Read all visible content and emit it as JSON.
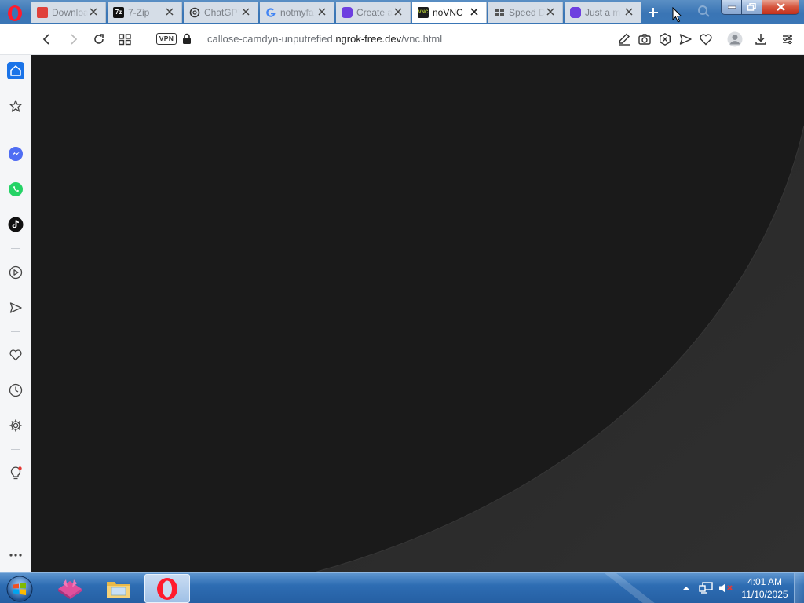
{
  "browser": {
    "name": "Opera",
    "tabs": [
      {
        "title": "Downloa",
        "favicon": "pdf-icon",
        "color": "#e0413b"
      },
      {
        "title": "7-Zip",
        "favicon": "7zip-icon",
        "color": "#111111"
      },
      {
        "title": "ChatGPT",
        "favicon": "chatgpt-icon",
        "color": "#333333"
      },
      {
        "title": "notmyfa",
        "favicon": "google-icon",
        "color": "#4285f4"
      },
      {
        "title": "Create a",
        "favicon": "app-icon",
        "color": "#6d3fe0"
      },
      {
        "title": "noVNC",
        "favicon": "novnc-icon",
        "color": "#1c1c1c",
        "active": true
      },
      {
        "title": "Speed D",
        "favicon": "speed-dial-icon",
        "color": "#2b3440"
      },
      {
        "title": "Just a m",
        "favicon": "app-icon",
        "color": "#6d3fe0"
      }
    ],
    "address_bar": {
      "vpn_label": "VPN",
      "url_prefix": "callose-camdyn-unputrefied.",
      "url_domain": "ngrok-free.dev",
      "url_path": "/vnc.html"
    }
  },
  "sidebar": {
    "items": [
      "home-icon",
      "bookmarks-icon",
      "messenger-icon",
      "whatsapp-icon",
      "tiktok-icon",
      "player-icon",
      "send-icon",
      "heart-icon",
      "history-icon",
      "settings-icon",
      "tips-icon",
      "more-icon"
    ]
  },
  "taskbar": {
    "apps": [
      "app-icon",
      "explorer-icon",
      "opera-icon"
    ],
    "clock": {
      "time": "4:01 AM",
      "date": "11/10/2025"
    }
  },
  "colors": {
    "tabstrip": "#3a75b5",
    "opera_red": "#ff1b2d",
    "content_bg": "#1a1a1a",
    "content_arc": "#2b2b2b"
  }
}
